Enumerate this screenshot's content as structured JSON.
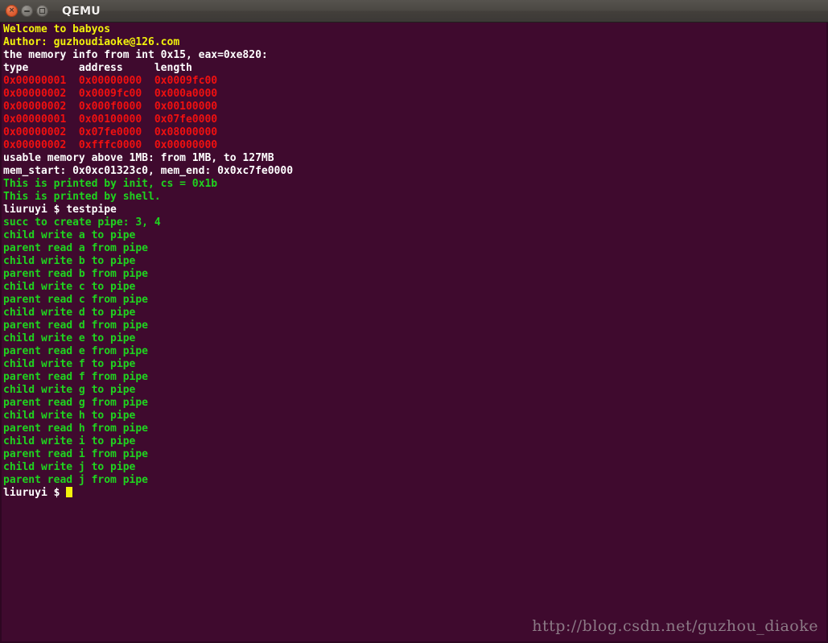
{
  "window": {
    "title": "QEMU",
    "controls": {
      "close_label": "×",
      "minimize_name": "minimize",
      "maximize_name": "maximize"
    }
  },
  "colors": {
    "terminal_bg": "#3f0a2e",
    "yellow": "#f2f20c",
    "white": "#ffffff",
    "red": "#f01010",
    "green": "#1fd41f",
    "titlebar": "#4b4843",
    "close_button": "#e2663a"
  },
  "terminal": {
    "banner": [
      {
        "text": "Welcome to babyos",
        "color": "yellow"
      },
      {
        "text": "Author: guzhoudiaoke@126.com",
        "color": "yellow"
      }
    ],
    "memory_info_heading": "the memory info from int 0x15, eax=0xe820:",
    "memory_table": {
      "headers": [
        "type",
        "address",
        "length"
      ],
      "rows": [
        [
          "0x00000001",
          "0x00000000",
          "0x0009fc00"
        ],
        [
          "0x00000002",
          "0x0009fc00",
          "0x000a0000"
        ],
        [
          "0x00000002",
          "0x000f0000",
          "0x00100000"
        ],
        [
          "0x00000001",
          "0x00100000",
          "0x07fe0000"
        ],
        [
          "0x00000002",
          "0x07fe0000",
          "0x08000000"
        ],
        [
          "0x00000002",
          "0xfffc0000",
          "0x00000000"
        ]
      ]
    },
    "usable_memory": "usable memory above 1MB: from 1MB, to 127MB",
    "mem_range": "mem_start: 0x0xc01323c0, mem_end: 0x0xc7fe0000",
    "init_messages": [
      "This is printed by init, cs = 0x1b",
      "This is printed by shell."
    ],
    "prompt": "liuruyi $ ",
    "command": "testpipe",
    "pipe_created": "succ to create pipe: 3, 4",
    "pipe_letters": [
      "a",
      "b",
      "c",
      "d",
      "e",
      "f",
      "g",
      "h",
      "i",
      "j"
    ],
    "child_write_template": "child write {L} to pipe",
    "parent_read_template": "parent read {L} from pipe",
    "final_prompt": "liuruyi $ "
  },
  "watermark": "http://blog.csdn.net/guzhou_diaoke"
}
